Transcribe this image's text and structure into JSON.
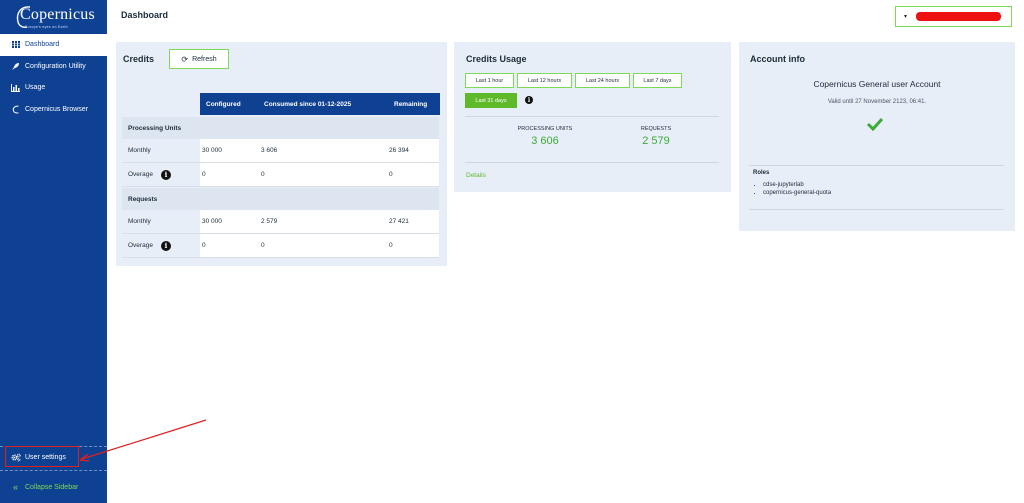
{
  "sidebar": {
    "logo": "Copernicus",
    "logo_tagline": "Europe's eyes on Earth",
    "items": [
      {
        "label": "Dashboard",
        "icon": "grid-icon"
      },
      {
        "label": "Configuration Utility",
        "icon": "rocket-icon"
      },
      {
        "label": "Usage",
        "icon": "bar-chart-icon"
      },
      {
        "label": "Copernicus Browser",
        "icon": "copernicus-c-icon"
      }
    ],
    "user_settings": "User settings",
    "collapse": "Collapse Sidebar"
  },
  "header": {
    "title": "Dashboard",
    "user_caret": "▾"
  },
  "credits": {
    "title": "Credits",
    "refresh_label": "Refresh",
    "columns": [
      "Configured",
      "Consumed since 01-12-2025",
      "Remaining"
    ],
    "groups": [
      {
        "name": "Processing Units",
        "rows": [
          {
            "label": "Monthly",
            "configured": "30 000",
            "consumed": "3 606",
            "remaining": "26 394"
          },
          {
            "label": "Overage",
            "configured": "0",
            "consumed": "0",
            "remaining": "0"
          }
        ]
      },
      {
        "name": "Requests",
        "rows": [
          {
            "label": "Monthly",
            "configured": "30 000",
            "consumed": "2 579",
            "remaining": "27 421"
          },
          {
            "label": "Overage",
            "configured": "0",
            "consumed": "0",
            "remaining": "0"
          }
        ]
      }
    ]
  },
  "usage": {
    "title": "Credits Usage",
    "ranges": [
      "Last 1 hour",
      "Last 12 hours",
      "Last 24 hours",
      "Last 7 days",
      "Last 31 days"
    ],
    "selected_range": "Last 31 days",
    "processing_units_label": "PROCESSING UNITS",
    "processing_units_value": "3 606",
    "requests_label": "REQUESTS",
    "requests_value": "2 579",
    "details_label": "Details"
  },
  "account": {
    "title": "Account info",
    "name": "Copernicus General user Account",
    "valid_until": "Valid until 27 November 2123, 06:41.",
    "roles_title": "Roles",
    "roles": [
      "cdse-jupyterlab",
      "copernicus-general-quota"
    ]
  },
  "colors": {
    "sidebar": "#0f4192",
    "accent_green": "#5fba2a",
    "card_bg": "#e8eef7",
    "annotation_red": "#e02020"
  }
}
